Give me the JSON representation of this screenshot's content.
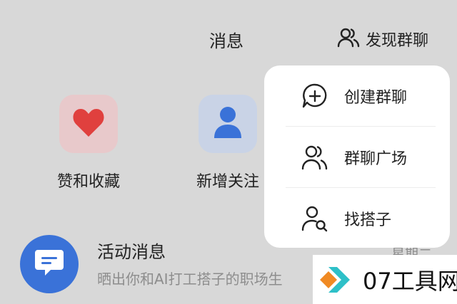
{
  "header": {
    "title": "消息",
    "discover_label": "发现群聊",
    "discover_icon": "users-icon"
  },
  "quick_actions": [
    {
      "label": "赞和收藏",
      "icon": "heart-icon",
      "color": "#e0403e"
    },
    {
      "label": "新增关注",
      "icon": "person-icon",
      "color": "#3a72d8"
    }
  ],
  "message": {
    "title": "活动消息",
    "preview": "晒出你和AI打工搭子的职场生",
    "time": "星期二",
    "icon": "chat-bubble-icon"
  },
  "popup_menu": [
    {
      "label": "创建群聊",
      "icon": "chat-add-icon"
    },
    {
      "label": "群聊广场",
      "icon": "users-icon"
    },
    {
      "label": "找搭子",
      "icon": "person-search-icon"
    }
  ],
  "watermark": {
    "text": "07工具网"
  }
}
